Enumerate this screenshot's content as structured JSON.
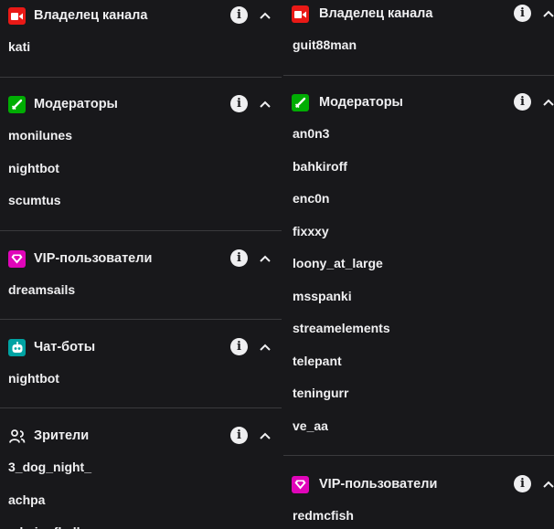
{
  "colors": {
    "background": "#18181b",
    "text": "#efeff1",
    "divider": "#3a3a3d",
    "owner_badge": "#e91916",
    "moderator_badge": "#00ad03",
    "vip_badge": "#e005b9",
    "bot_badge": "#00a3a3"
  },
  "left_panel": {
    "owner": {
      "title": "Владелец канала",
      "icon": "video-camera-icon",
      "users": [
        "kati"
      ]
    },
    "moderators": {
      "title": "Модераторы",
      "icon": "sword-icon",
      "users": [
        "monilunes",
        "nightbot",
        "scumtus"
      ]
    },
    "vip": {
      "title": "VIP-пользователи",
      "icon": "diamond-icon",
      "users": [
        "dreamsails"
      ]
    },
    "bots": {
      "title": "Чат-боты",
      "icon": "robot-icon",
      "users": [
        "nightbot"
      ]
    },
    "viewers": {
      "title": "Зрители",
      "icon": "viewers-icon",
      "users": [
        "3_dog_night_",
        "achpa",
        "adminofhell"
      ]
    }
  },
  "right_panel": {
    "owner": {
      "title": "Владелец канала",
      "icon": "video-camera-icon",
      "users": [
        "guit88man"
      ]
    },
    "moderators": {
      "title": "Модераторы",
      "icon": "sword-icon",
      "users": [
        "an0n3",
        "bahkiroff",
        "enc0n",
        "fixxxy",
        "loony_at_large",
        "msspanki",
        "streamelements",
        "telepant",
        "teningurr",
        "ve_aa"
      ]
    },
    "vip": {
      "title": "VIP-пользователи",
      "icon": "diamond-icon",
      "users": [
        "redmcfish"
      ]
    }
  }
}
